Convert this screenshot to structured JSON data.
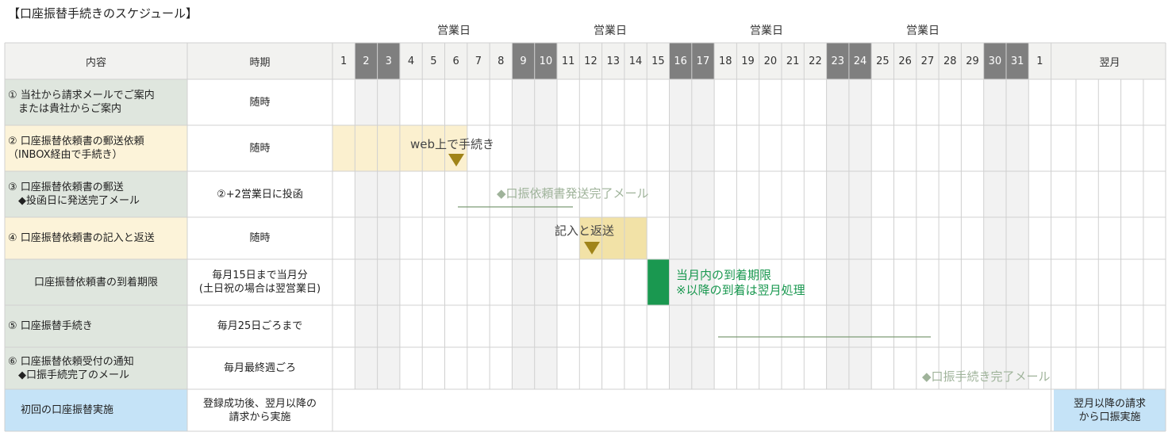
{
  "title": "【口座振替手続きのスケジュール】",
  "business_day_label": "営業日",
  "header": {
    "content": "内容",
    "period": "時期",
    "next_month": "翌月"
  },
  "days": [
    "1",
    "2",
    "3",
    "4",
    "5",
    "6",
    "7",
    "8",
    "9",
    "10",
    "11",
    "12",
    "13",
    "14",
    "15",
    "16",
    "17",
    "18",
    "19",
    "20",
    "21",
    "22",
    "23",
    "24",
    "25",
    "26",
    "27",
    "28",
    "29",
    "30",
    "31",
    "1"
  ],
  "holiday_days": [
    "2",
    "3",
    "9",
    "10",
    "16",
    "17",
    "23",
    "24",
    "30",
    "31"
  ],
  "rows": [
    {
      "label": [
        "① 当社から請求メールでご案内",
        "　または貴社からご案内"
      ],
      "period": [
        "随時"
      ]
    },
    {
      "label": [
        "② 口座振替依頼書の郵送依頼",
        "（INBOX経由で手続き）"
      ],
      "period": [
        "随時"
      ]
    },
    {
      "label": [
        "③ 口座振替依頼書の郵送",
        "　◆投函日に発送完了メール"
      ],
      "period": [
        "②+2営業日に投函"
      ]
    },
    {
      "label": [
        "④ 口座振替依頼書の記入と返送"
      ],
      "period": [
        "随時"
      ]
    },
    {
      "label": [
        "口座振替依頼書の到着期限"
      ],
      "period": [
        "毎月15日まで当月分",
        "(土日祝の場合は翌営業日)"
      ]
    },
    {
      "label": [
        "⑤ 口座振替手続き"
      ],
      "period": [
        "毎月25日ごろまで"
      ]
    },
    {
      "label": [
        "⑥ 口座振替依頼受付の通知",
        "　◆口振手続完了のメール"
      ],
      "period": [
        "毎月最終週ごろ"
      ]
    },
    {
      "label": [
        "初回の口座振替実施"
      ],
      "period": [
        "登録成功後、翌月以降の",
        "請求から実施"
      ]
    }
  ],
  "annotations": {
    "web": "web上で手続き",
    "sent_mail": "◆口振依頼書発送完了メール",
    "fill_return": "記入と返送",
    "deadline_1": "当月内の到着期限",
    "deadline_2": "※以降の到着は翌月処理",
    "done_mail": "◆口振手続き完了メール",
    "next_month_1": "翌月以降の請求",
    "next_month_2": "から口振実施"
  },
  "colors": {
    "header_bg": "#f2f2f0",
    "holiday_header": "#7f7f7f",
    "holiday_col": "#f2f2f2",
    "label_green": "#dfe6de",
    "label_yellow": "#fcf3d9",
    "label_blue": "#c5e3f7",
    "web_band": "#fbf0cf",
    "return_band": "#f2e2a7",
    "arrow": "#a08419",
    "deadline_green": "#1a9850",
    "muted_green": "#9fb39a",
    "line_green": "#7e9c76",
    "grid": "#d0d0d0"
  }
}
